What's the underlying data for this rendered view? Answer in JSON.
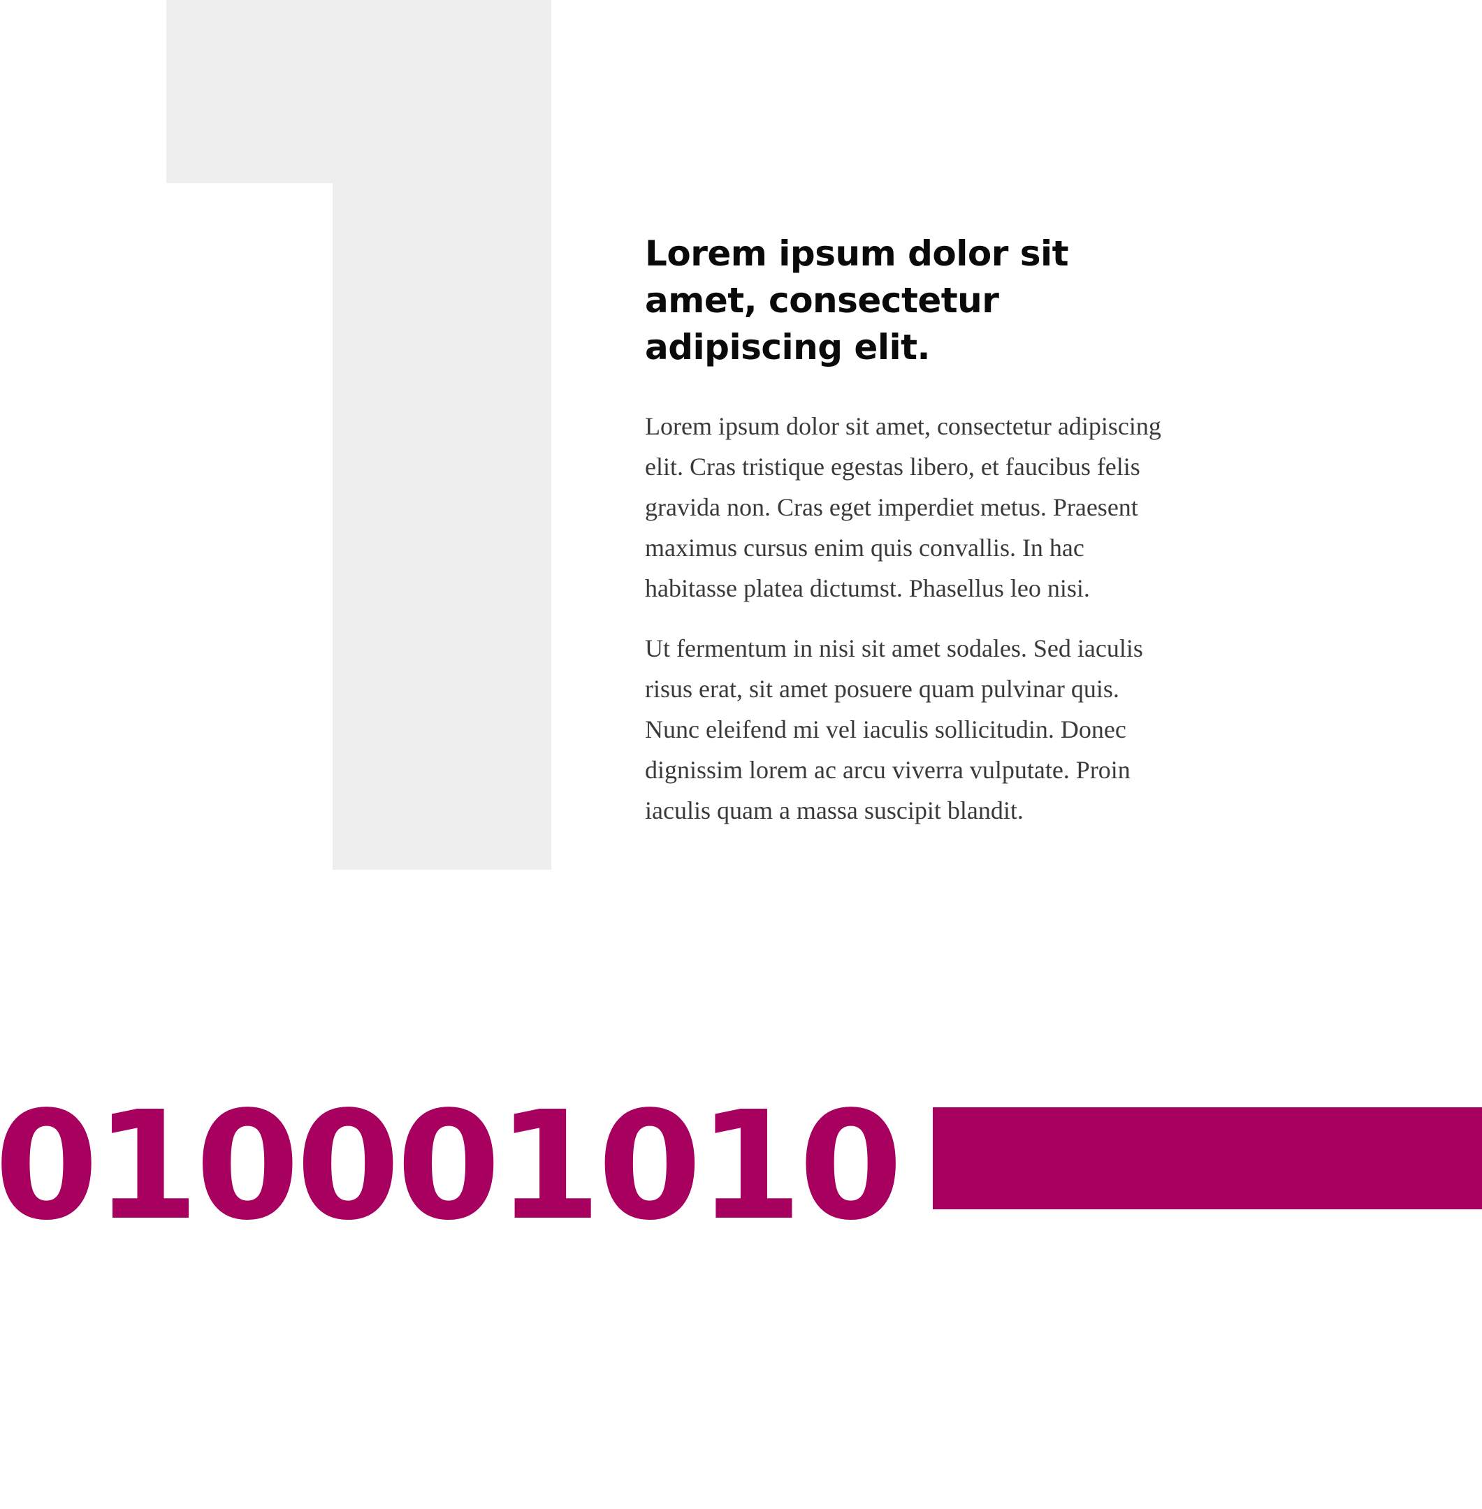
{
  "article": {
    "headline": "Lorem ipsum dolor sit amet, consectetur adipiscing elit.",
    "paragraphs": [
      "Lorem ipsum dolor sit amet, consectetur adipiscing elit. Cras tristique egestas libero, et faucibus felis gravida non. Cras eget imperdiet metus. Praesent maximus cursus enim quis convallis. In hac habitasse platea dictumst. Phasellus leo nisi.",
      "Ut fermentum in nisi sit amet sodales. Sed iaculis risus erat, sit amet posuere quam pulvinar quis. Nunc eleifend mi vel iaculis sollicitudin. Donec dignissim lorem ac arcu viverra vulputate. Proin iaculis quam a massa suscipit blandit."
    ]
  },
  "footer_graphic": {
    "binary": "010001010"
  },
  "colors": {
    "accent": "#a8005e",
    "decoration": "#eeeeee",
    "heading": "#0a0a0a",
    "body_text": "#3a3a3a"
  }
}
